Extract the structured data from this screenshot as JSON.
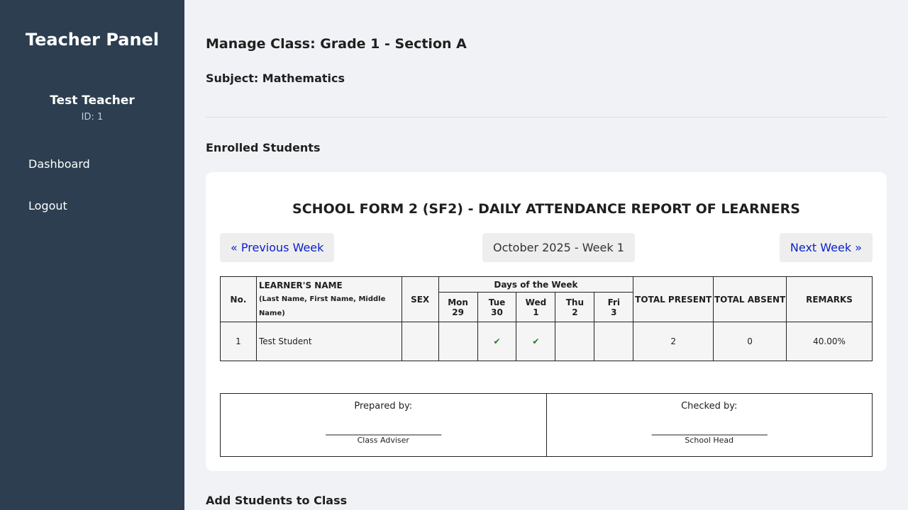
{
  "sidebar": {
    "title": "Teacher Panel",
    "user_name": "Test Teacher",
    "user_id": "ID: 1",
    "nav": [
      {
        "label": "Dashboard"
      },
      {
        "label": "Logout"
      }
    ]
  },
  "main": {
    "manage_heading": "Manage Class: Grade 1 - Section A",
    "subject_heading": "Subject: Mathematics",
    "enrolled_heading": "Enrolled Students",
    "add_heading": "Add Students to Class"
  },
  "report": {
    "title": "SCHOOL FORM 2 (SF2) - DAILY ATTENDANCE REPORT OF LEARNERS",
    "prev_label": "« Previous Week",
    "period_label": "October 2025 - Week 1",
    "next_label": "Next Week »",
    "headers": {
      "no": "No.",
      "name": "LEARNER'S NAME",
      "name_sub": "(Last Name, First Name, Middle Name)",
      "sex": "SEX",
      "days_group": "Days of the Week",
      "total_present": "TOTAL PRESENT",
      "total_absent": "TOTAL ABSENT",
      "remarks": "REMARKS"
    },
    "days": [
      {
        "day": "Mon",
        "date": "29"
      },
      {
        "day": "Tue",
        "date": "30"
      },
      {
        "day": "Wed",
        "date": "1"
      },
      {
        "day": "Thu",
        "date": "2"
      },
      {
        "day": "Fri",
        "date": "3"
      }
    ],
    "rows": [
      {
        "no": "1",
        "name": "Test Student",
        "sex": "",
        "marks": [
          "",
          "✔",
          "✔",
          "",
          ""
        ],
        "total_present": "2",
        "total_absent": "0",
        "remarks": "40.00%"
      }
    ],
    "signatures": {
      "prepared_label": "Prepared by:",
      "prepared_role": "Class Adviser",
      "checked_label": "Checked by:",
      "checked_role": "School Head",
      "line": "___________________________"
    }
  },
  "colors": {
    "sidebar_bg": "#2c3e50",
    "page_bg": "#f0f2f5",
    "link": "#0a21c8",
    "check": "#1e7d1e"
  }
}
